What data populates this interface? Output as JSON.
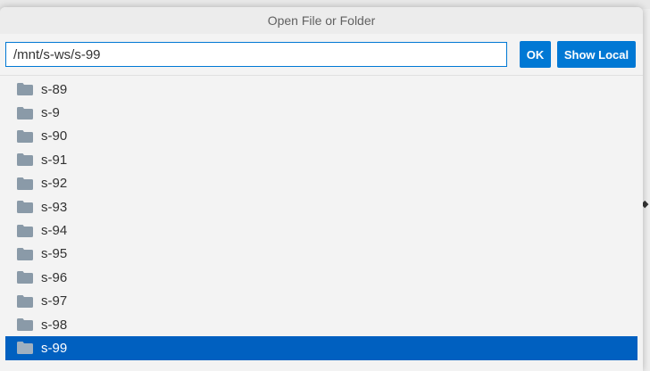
{
  "dialog": {
    "title": "Open File or Folder",
    "path_value": "/mnt/s-ws/s-99",
    "ok_label": "OK",
    "show_local_label": "Show Local"
  },
  "list": {
    "items": [
      {
        "label": "s-89",
        "selected": false
      },
      {
        "label": "s-9",
        "selected": false
      },
      {
        "label": "s-90",
        "selected": false
      },
      {
        "label": "s-91",
        "selected": false
      },
      {
        "label": "s-92",
        "selected": false
      },
      {
        "label": "s-93",
        "selected": false
      },
      {
        "label": "s-94",
        "selected": false
      },
      {
        "label": "s-95",
        "selected": false
      },
      {
        "label": "s-96",
        "selected": false
      },
      {
        "label": "s-97",
        "selected": false
      },
      {
        "label": "s-98",
        "selected": false
      },
      {
        "label": "s-99",
        "selected": true
      }
    ],
    "item_icon": "folder-icon"
  },
  "colors": {
    "accent": "#0078d4",
    "selection": "#0060c0",
    "folder": "#8a9aa8"
  }
}
